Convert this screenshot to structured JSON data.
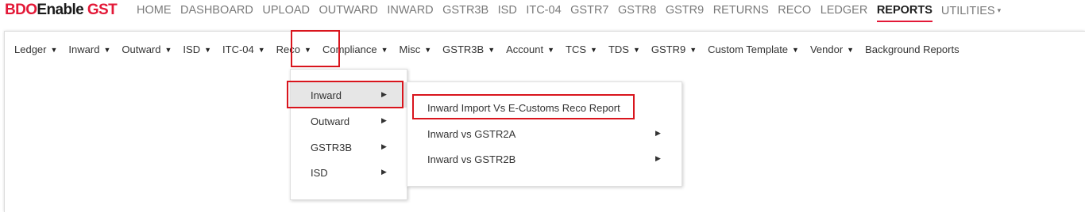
{
  "brand": {
    "part1": "BDO",
    "part2": "Enable",
    "part3": "GST"
  },
  "main_nav": [
    {
      "label": "HOME"
    },
    {
      "label": "DASHBOARD"
    },
    {
      "label": "UPLOAD"
    },
    {
      "label": "OUTWARD"
    },
    {
      "label": "INWARD"
    },
    {
      "label": "GSTR3B"
    },
    {
      "label": "ISD"
    },
    {
      "label": "ITC-04"
    },
    {
      "label": "GSTR7"
    },
    {
      "label": "GSTR8"
    },
    {
      "label": "GSTR9"
    },
    {
      "label": "RETURNS"
    },
    {
      "label": "RECO"
    },
    {
      "label": "LEDGER"
    },
    {
      "label": "REPORTS",
      "active": true
    },
    {
      "label": "UTILITIES",
      "caret": "▾"
    }
  ],
  "sub_nav": [
    {
      "label": "Ledger",
      "caret": "▼"
    },
    {
      "label": "Inward",
      "caret": "▼"
    },
    {
      "label": "Outward",
      "caret": "▼"
    },
    {
      "label": "ISD",
      "caret": "▼"
    },
    {
      "label": "ITC-04",
      "caret": "▼"
    },
    {
      "label": "Reco",
      "caret": "▼"
    },
    {
      "label": "Compliance",
      "caret": "▼"
    },
    {
      "label": "Misc",
      "caret": "▼"
    },
    {
      "label": "GSTR3B",
      "caret": "▼"
    },
    {
      "label": "Account",
      "caret": "▼"
    },
    {
      "label": "TCS",
      "caret": "▼"
    },
    {
      "label": "TDS",
      "caret": "▼"
    },
    {
      "label": "GSTR9",
      "caret": "▼"
    },
    {
      "label": "Custom Template",
      "caret": "▼"
    },
    {
      "label": "Vendor",
      "caret": "▼"
    },
    {
      "label": "Background Reports"
    }
  ],
  "reco_menu": [
    {
      "label": "Inward",
      "arrow": "▶"
    },
    {
      "label": "Outward",
      "arrow": "▶"
    },
    {
      "label": "GSTR3B",
      "arrow": "▶"
    },
    {
      "label": "ISD",
      "arrow": "▶"
    }
  ],
  "inward_submenu": [
    {
      "label": "Inward Import Vs E-Customs Reco Report"
    },
    {
      "label": "Inward vs GSTR2A",
      "arrow": "▶"
    },
    {
      "label": "Inward vs GSTR2B",
      "arrow": "▶"
    }
  ],
  "colors": {
    "brand_red": "#e31837",
    "highlight_red": "#d9151d",
    "nav_gray": "#7a7a7a"
  },
  "icons": {
    "dropdown_caret": "caret-down-icon",
    "submenu_arrow": "caret-right-icon"
  }
}
